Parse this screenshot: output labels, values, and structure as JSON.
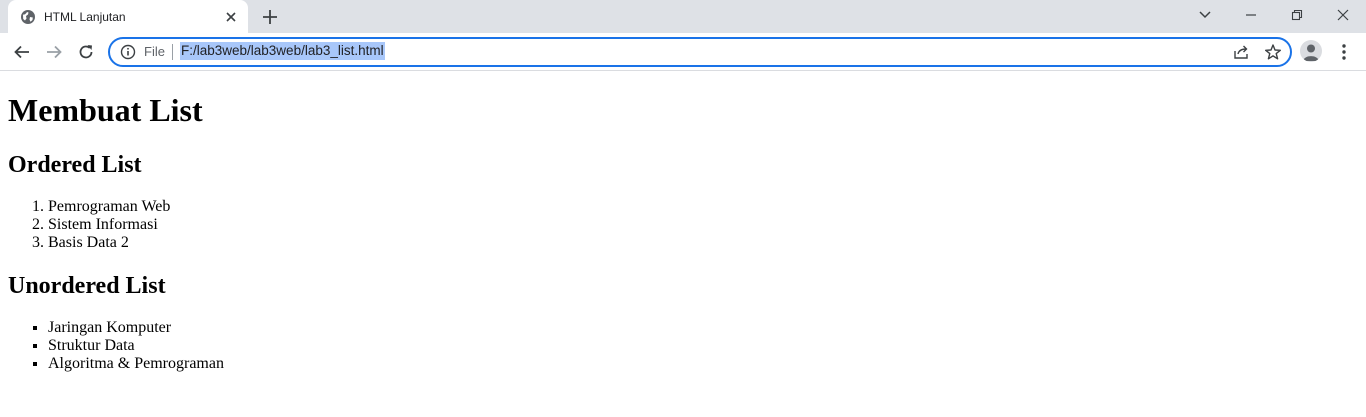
{
  "browser": {
    "tab": {
      "title": "HTML Lanjutan",
      "favicon_icon": "globe-icon",
      "close_icon": "close-icon"
    },
    "new_tab_icon": "plus-icon",
    "window_controls": [
      "chevron-down-icon",
      "minimize-icon",
      "restore-icon",
      "close-icon"
    ],
    "nav": [
      "back-arrow-icon",
      "forward-arrow-icon",
      "reload-icon"
    ],
    "address_bar": {
      "info_icon": "info-icon",
      "scheme_label": "File",
      "url": "F:/lab3web/lab3web/lab3_list.html",
      "share_icon": "share-icon",
      "bookmark_icon": "star-icon"
    },
    "profile_icon": "avatar-icon",
    "menu_icon": "kebab-menu-icon",
    "accent_color": "#1a73e8",
    "selection_color": "#a8c7fa"
  },
  "page": {
    "heading": "Membuat List",
    "ordered": {
      "heading": "Ordered List",
      "items": [
        "Pemrograman Web",
        "Sistem Informasi",
        "Basis Data 2"
      ]
    },
    "unordered": {
      "heading": "Unordered List",
      "items": [
        "Jaringan Komputer",
        "Struktur Data",
        "Algoritma & Pemrograman"
      ]
    }
  }
}
